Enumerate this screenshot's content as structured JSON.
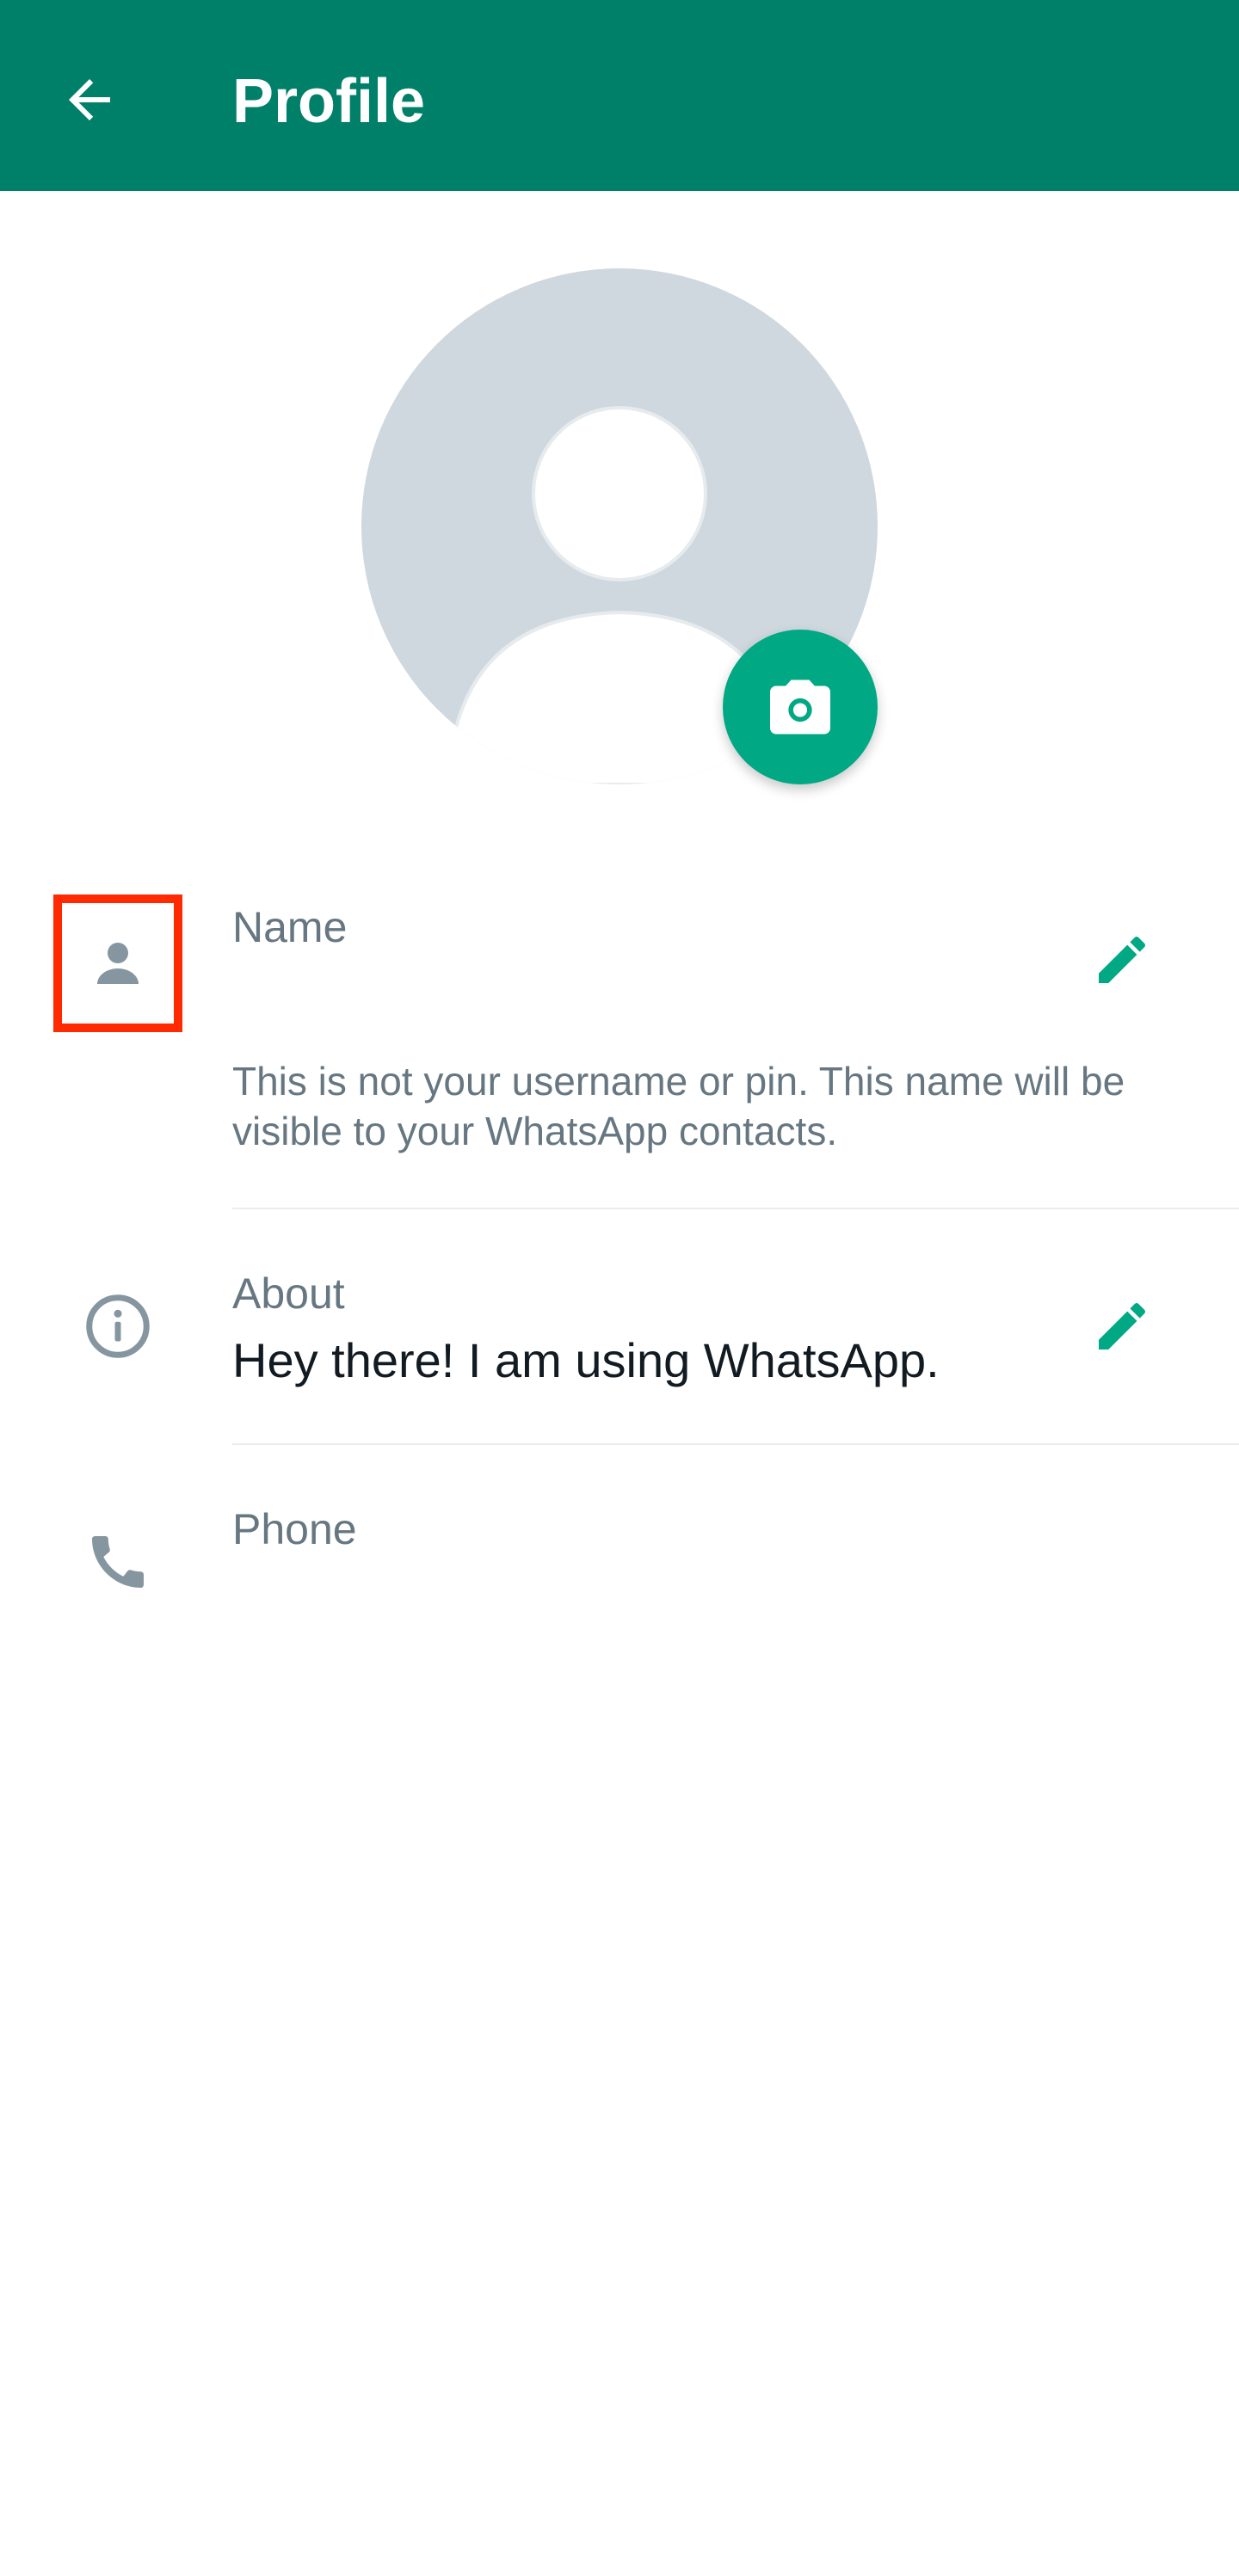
{
  "header": {
    "title": "Profile",
    "back_icon": "arrow-left-icon",
    "background": "#008069"
  },
  "avatar": {
    "icon": "default-avatar-icon",
    "camera_icon": "camera-icon",
    "accent": "#00a884"
  },
  "rows": {
    "name": {
      "icon": "person-icon",
      "label": "Name",
      "value": "",
      "hint": "This is not your username or pin. This name will be visible to your WhatsApp contacts.",
      "edit_icon": "pencil-icon",
      "highlighted": true
    },
    "about": {
      "icon": "info-icon",
      "label": "About",
      "value": "Hey there! I am using WhatsApp.",
      "edit_icon": "pencil-icon"
    },
    "phone": {
      "icon": "phone-icon",
      "label": "Phone",
      "value": ""
    }
  },
  "colors": {
    "icon_gray": "#8696a0",
    "label_gray": "#667781",
    "text_dark": "#111b21",
    "highlight": "#ff2a00"
  }
}
